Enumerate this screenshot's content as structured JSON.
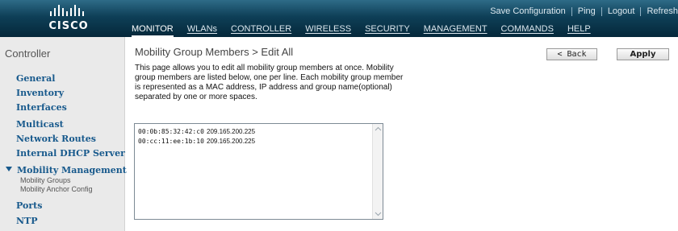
{
  "brand": {
    "logo_text": "CISCO"
  },
  "utility_links": [
    "Save Configuration",
    "Ping",
    "Logout",
    "Refresh"
  ],
  "nav": {
    "active": "MONITOR",
    "items": [
      "MONITOR",
      "WLANs",
      "CONTROLLER",
      "WIRELESS",
      "SECURITY",
      "MANAGEMENT",
      "COMMANDS",
      "HELP"
    ]
  },
  "sidebar": {
    "title": "Controller",
    "items": [
      "General",
      "Inventory",
      "Interfaces",
      "Multicast",
      "Network Routes",
      "Internal DHCP Server"
    ],
    "expanded_item": "Mobility Management",
    "sub_items": [
      "Mobility Groups",
      "Mobility Anchor Config"
    ],
    "items_after": [
      "Ports",
      "NTP"
    ]
  },
  "main": {
    "title": "Mobility Group Members > Edit All",
    "description": "This page allows you to edit all mobility group members at once. Mobility group members are listed below, one per line. Each mobility group member is represented as a MAC address, IP address and group name(optional) separated by one or more spaces.",
    "back_label": "< Back",
    "apply_label": "Apply",
    "members": [
      {
        "mac": "00:0b:85:32:42:c0",
        "ip": "209.165.200.225"
      },
      {
        "mac": "00:cc:11:ee:1b:10",
        "ip": "209.165.200.225"
      }
    ]
  }
}
